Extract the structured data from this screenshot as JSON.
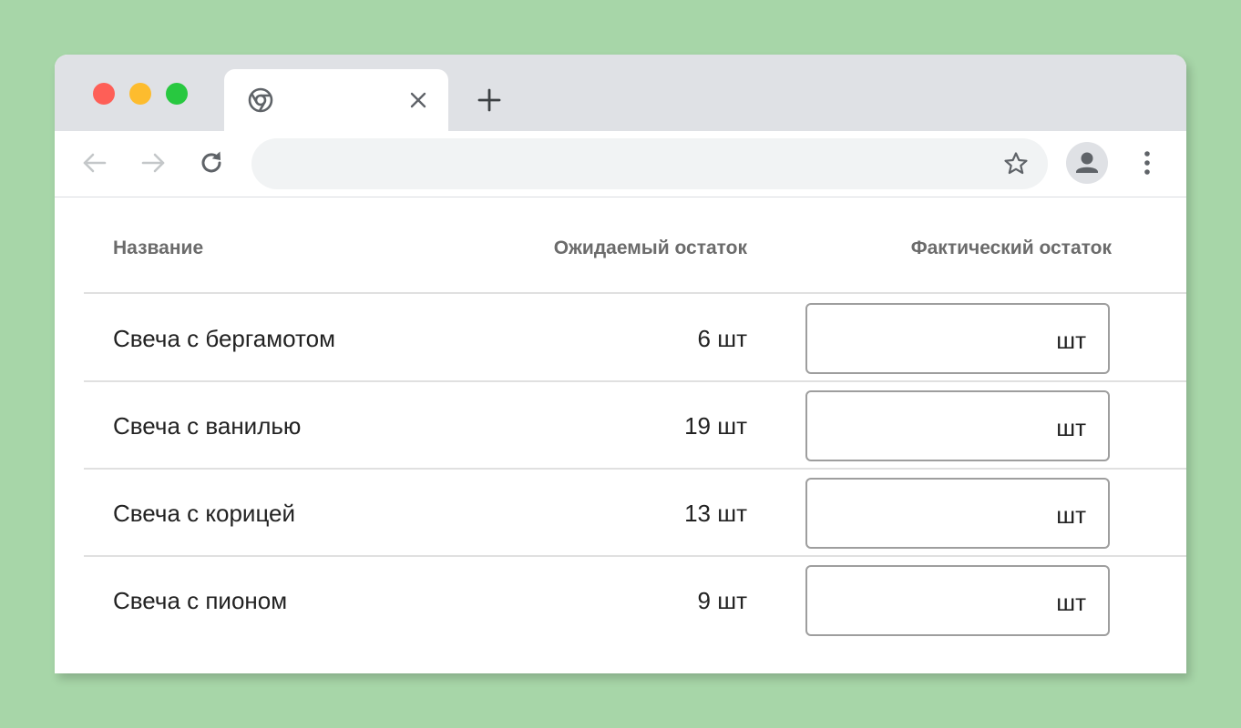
{
  "browser": {
    "tab": {
      "title": "",
      "close_icon": "close-icon",
      "favicon": "chrome-icon"
    },
    "new_tab_icon": "plus-icon",
    "toolbar": {
      "back_icon": "arrow-left-icon",
      "forward_icon": "arrow-right-icon",
      "reload_icon": "reload-icon",
      "address_value": "",
      "bookmark_icon": "star-icon",
      "profile_icon": "person-icon",
      "menu_icon": "more-vertical-icon"
    },
    "colors": {
      "background": "#a7d6a8",
      "tabstrip": "#dfe1e5",
      "traffic_red": "#fe5f57",
      "traffic_yellow": "#fdbc2e",
      "traffic_green": "#28c840"
    }
  },
  "table": {
    "headers": {
      "name": "Название",
      "expected": "Ожидаемый остаток",
      "actual": "Фактический остаток"
    },
    "rows": [
      {
        "name": "Свеча с бергамотом",
        "expected": "6 шт",
        "actual_value": "",
        "unit": "шт"
      },
      {
        "name": "Свеча с ванилью",
        "expected": "19 шт",
        "actual_value": "",
        "unit": "шт"
      },
      {
        "name": "Свеча с корицей",
        "expected": "13 шт",
        "actual_value": "",
        "unit": "шт"
      },
      {
        "name": "Свеча с пионом",
        "expected": "9 шт",
        "actual_value": "",
        "unit": "шт"
      }
    ]
  }
}
